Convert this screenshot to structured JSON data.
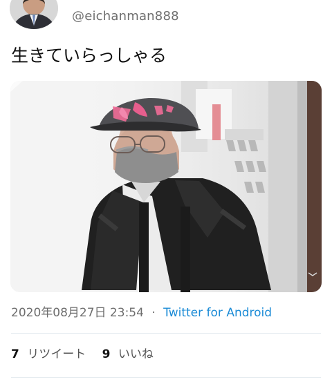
{
  "tweet": {
    "author": {
      "handle": "@eichanman888"
    },
    "text": "生きていらっしゃる",
    "timestamp": "2020年08月27日 23:54",
    "separator": "·",
    "source": "Twitter for Android"
  },
  "stats": {
    "retweets": {
      "count": "7",
      "label": "リツイート"
    },
    "likes": {
      "count": "9",
      "label": "いいね"
    }
  },
  "colors": {
    "link": "#1b8bd6",
    "muted": "#6e6e6e",
    "divider": "#e6ecf0"
  }
}
